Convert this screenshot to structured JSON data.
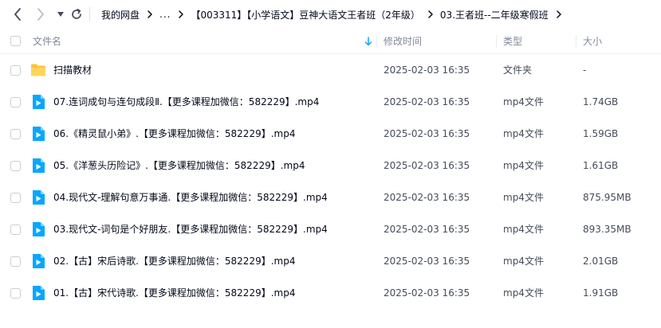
{
  "nav": {
    "back_icon": "chevron-left-icon",
    "forward_icon": "chevron-right-icon",
    "history_icon": "caret-down-icon",
    "refresh_icon": "refresh-icon"
  },
  "breadcrumb": {
    "root": "我的网盘",
    "ellipsis": "...",
    "items": [
      "【003311】【小学语文】豆神大语文王者班（2年级）",
      "03.王者班--二年级寒假班"
    ]
  },
  "header": {
    "name": "文件名",
    "modified": "修改时间",
    "type": "类型",
    "size": "大小"
  },
  "files": [
    {
      "icon": "folder-icon",
      "name": "扫描教材",
      "date": "2025-02-03 16:35",
      "type": "文件夹",
      "size": "-"
    },
    {
      "icon": "video-file-icon",
      "name": "07.连词成句与连句成段Ⅱ.【更多课程加微信：582229】.mp4",
      "date": "2025-02-03 16:35",
      "type": "mp4文件",
      "size": "1.74GB"
    },
    {
      "icon": "video-file-icon",
      "name": "06.《精灵鼠小弟》.【更多课程加微信：582229】.mp4",
      "date": "2025-02-03 16:35",
      "type": "mp4文件",
      "size": "1.59GB"
    },
    {
      "icon": "video-file-icon",
      "name": "05.《洋葱头历险记》.【更多课程加微信：582229】.mp4",
      "date": "2025-02-03 16:35",
      "type": "mp4文件",
      "size": "1.61GB"
    },
    {
      "icon": "video-file-icon",
      "name": "04.现代文-理解句意万事通.【更多课程加微信：582229】.mp4",
      "date": "2025-02-03 16:35",
      "type": "mp4文件",
      "size": "875.95MB"
    },
    {
      "icon": "video-file-icon",
      "name": "03.现代文-词句是个好朋友.【更多课程加微信：582229】.mp4",
      "date": "2025-02-03 16:35",
      "type": "mp4文件",
      "size": "893.35MB"
    },
    {
      "icon": "video-file-icon",
      "name": "02.【古】宋后诗歌.【更多课程加微信：582229】.mp4",
      "date": "2025-02-03 16:35",
      "type": "mp4文件",
      "size": "2.01GB"
    },
    {
      "icon": "video-file-icon",
      "name": "01.【古】宋代诗歌.【更多课程加微信：582229】.mp4",
      "date": "2025-02-03 16:35",
      "type": "mp4文件",
      "size": "1.91GB"
    }
  ],
  "colors": {
    "accent": "#06a7ff",
    "folder": "#ffc338",
    "text": "#03081a",
    "muted": "#818999"
  }
}
